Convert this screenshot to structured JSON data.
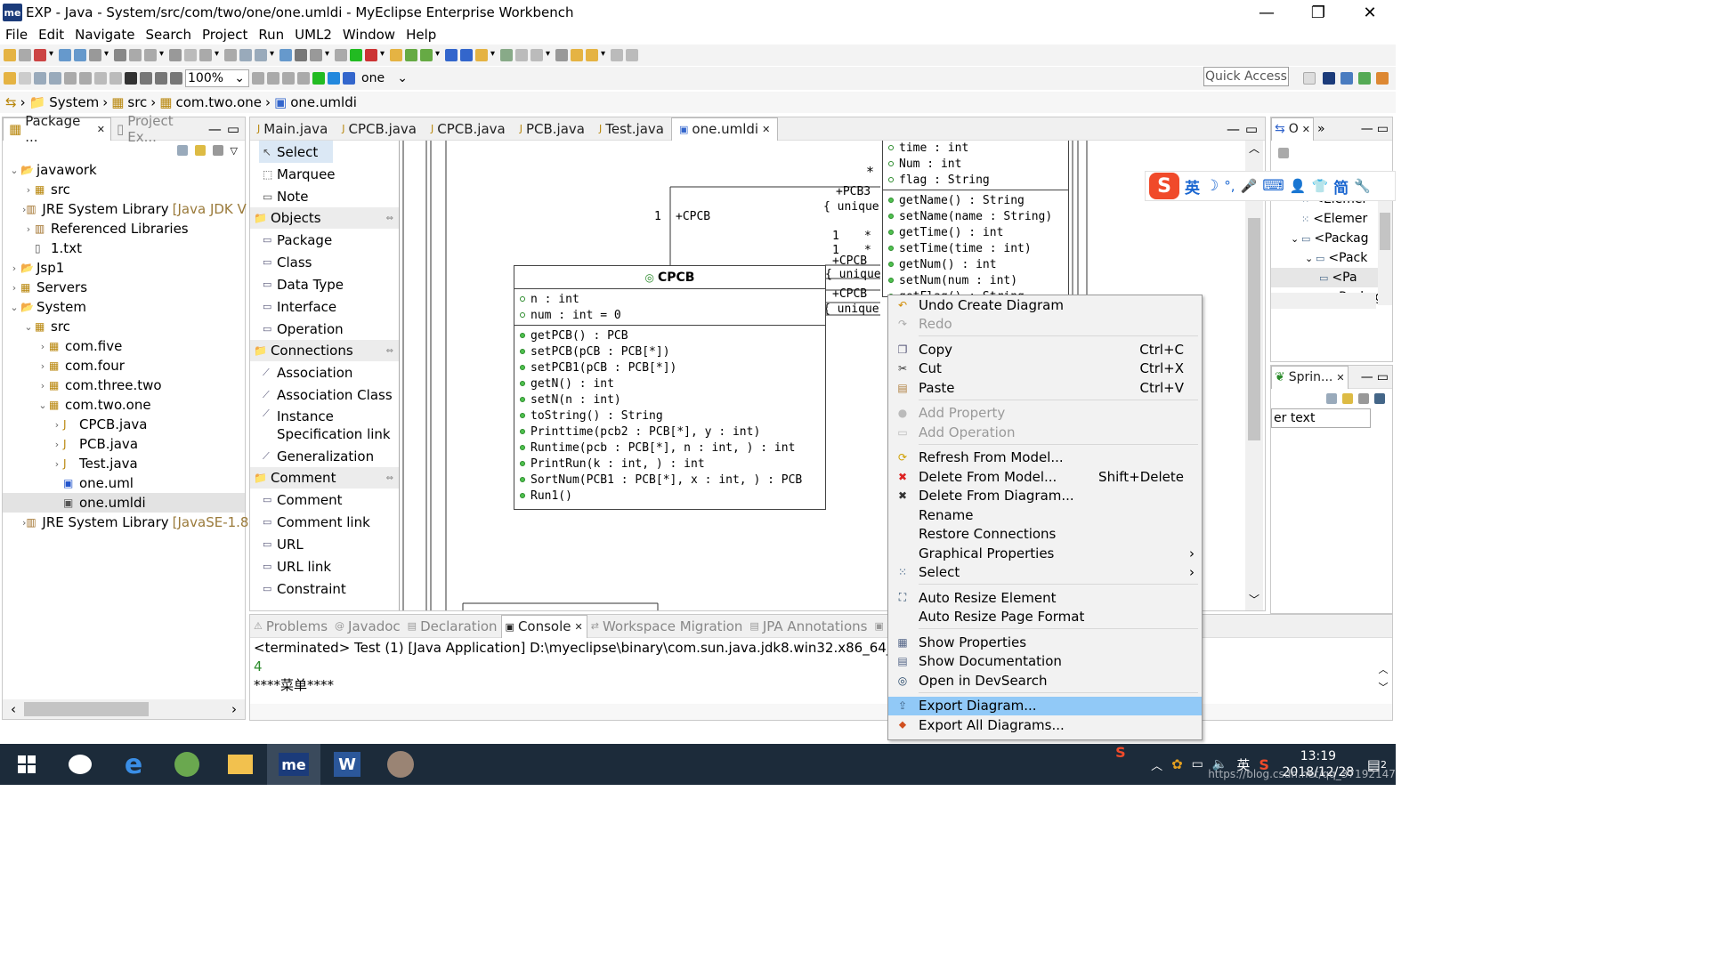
{
  "window": {
    "title": "EXP - Java - System/src/com/two/one/one.umldi - MyEclipse Enterprise Workbench",
    "app_icon": "me",
    "minimize": "—",
    "restore": "❐",
    "close": "✕"
  },
  "menu": [
    "File",
    "Edit",
    "Navigate",
    "Search",
    "Project",
    "Run",
    "UML2",
    "Window",
    "Help"
  ],
  "toolbar": {
    "zoom": "100%",
    "context": "one",
    "quick_access": "Quick Access"
  },
  "breadcrumb": [
    "System",
    "src",
    "com.two.one",
    "one.umldi"
  ],
  "explorer": {
    "tabs": [
      "Package ...",
      "Project Ex..."
    ],
    "tree": [
      {
        "label": "javawork",
        "level": 0,
        "exp": "v",
        "kind": "project"
      },
      {
        "label": "src",
        "level": 1,
        "exp": ">",
        "kind": "folder"
      },
      {
        "label": "JRE System Library",
        "decor": "[Java JDK V",
        "level": 1,
        "exp": ">",
        "kind": "lib"
      },
      {
        "label": "Referenced Libraries",
        "level": 1,
        "exp": ">",
        "kind": "lib"
      },
      {
        "label": "1.txt",
        "level": 1,
        "exp": "",
        "kind": "file"
      },
      {
        "label": "Jsp1",
        "level": 0,
        "exp": ">",
        "kind": "project"
      },
      {
        "label": "Servers",
        "level": 0,
        "exp": ">",
        "kind": "folder"
      },
      {
        "label": "System",
        "level": 0,
        "exp": "v",
        "kind": "project"
      },
      {
        "label": "src",
        "level": 1,
        "exp": "v",
        "kind": "folder"
      },
      {
        "label": "com.five",
        "level": 2,
        "exp": ">",
        "kind": "package"
      },
      {
        "label": "com.four",
        "level": 2,
        "exp": ">",
        "kind": "package"
      },
      {
        "label": "com.three.two",
        "level": 2,
        "exp": ">",
        "kind": "package"
      },
      {
        "label": "com.two.one",
        "level": 2,
        "exp": "v",
        "kind": "package"
      },
      {
        "label": "CPCB.java",
        "level": 3,
        "exp": ">",
        "kind": "java"
      },
      {
        "label": "PCB.java",
        "level": 3,
        "exp": ">",
        "kind": "java"
      },
      {
        "label": "Test.java",
        "level": 3,
        "exp": ">",
        "kind": "java"
      },
      {
        "label": "one.uml",
        "level": 3,
        "exp": "",
        "kind": "uml"
      },
      {
        "label": "one.umldi",
        "level": 3,
        "exp": "",
        "kind": "umldi",
        "selected": true
      },
      {
        "label": "JRE System Library",
        "decor": "[JavaSE-1.8]",
        "level": 1,
        "exp": ">",
        "kind": "lib"
      }
    ]
  },
  "editor_tabs": [
    "Main.java",
    "CPCB.java",
    "CPCB.java",
    "PCB.java",
    "Test.java",
    "one.umldi"
  ],
  "palette": {
    "tools": [
      "Select",
      "Marquee",
      "Note"
    ],
    "sections": [
      {
        "title": "Objects",
        "items": [
          "Package",
          "Class",
          "Data Type",
          "Interface",
          "Operation"
        ]
      },
      {
        "title": "Connections",
        "items": [
          "Association",
          "Association Class",
          "Instance Specification link",
          "Generalization"
        ]
      },
      {
        "title": "Comment",
        "items": [
          "Comment",
          "Comment link",
          "URL",
          "URL link",
          "Constraint"
        ]
      }
    ]
  },
  "diagram": {
    "class_name": "CPCB",
    "attributes": [
      "n : int",
      "num : int = 0"
    ],
    "operations": [
      "getPCB() : PCB",
      "setPCB(pCB : PCB[*])",
      "setPCB1(pCB : PCB[*])",
      "getN() : int",
      "setN(n : int)",
      "toString() : String",
      "Printtime(pcb2 : PCB[*], y : int)",
      "Runtime(pcb : PCB[*], n : int, ) : int",
      "PrintRun(k : int, ) : int",
      "SortNum(PCB1 : PCB[*], x : int, ) : PCB",
      "Run1()"
    ],
    "pcb_attributes": [
      "time : int",
      "Num : int",
      "flag : String"
    ],
    "pcb_operations": [
      "getName() : String",
      "setName(name : String)",
      "getTime() : int",
      "setTime(time : int)",
      "getNum() : int",
      "setNum(num : int)",
      "getFlag() : String"
    ],
    "labels": {
      "star1": "*",
      "pcb3": "+PCB3",
      "unique1": "{ unique",
      "one1": "1",
      "cpcb": "+CPCB",
      "one2": "1",
      "star2": "*",
      "one3": "1",
      "star3": "*",
      "m1": "+CPCB",
      "m2": "{ unique",
      "m3": "+CPCB",
      "m4": "{ unique",
      "unique3": "{ unique"
    }
  },
  "context_menu": [
    {
      "label": "Undo Create Diagram",
      "icon": "↶",
      "c": "#d08a00"
    },
    {
      "label": "Redo",
      "icon": "↷",
      "c": "#aaa",
      "disabled": true
    },
    {
      "sep": true
    },
    {
      "label": "Copy",
      "shortcut": "Ctrl+C",
      "icon": "❐",
      "c": "#557"
    },
    {
      "label": "Cut",
      "shortcut": "Ctrl+X",
      "icon": "✂",
      "c": "#333"
    },
    {
      "label": "Paste",
      "shortcut": "Ctrl+V",
      "icon": "▤",
      "c": "#b08040"
    },
    {
      "sep": true
    },
    {
      "label": "Add Property",
      "icon": "●",
      "c": "#bbb",
      "disabled": true
    },
    {
      "label": "Add Operation",
      "icon": "▭",
      "c": "#bbb",
      "disabled": true
    },
    {
      "sep": true
    },
    {
      "label": "Refresh From Model...",
      "icon": "⟳",
      "c": "#d0a000"
    },
    {
      "label": "Delete From Model...",
      "shortcut": "Shift+Delete",
      "icon": "✖",
      "c": "#d22"
    },
    {
      "label": "Delete From Diagram...",
      "icon": "✖",
      "c": "#333"
    },
    {
      "label": "Rename",
      "icon": "",
      "c": "#333"
    },
    {
      "label": "Restore Connections",
      "icon": "",
      "c": "#333"
    },
    {
      "label": "Graphical Properties",
      "submenu": true,
      "icon": "",
      "c": "#333"
    },
    {
      "label": "Select",
      "submenu": true,
      "icon": "⁙",
      "c": "#468"
    },
    {
      "sep": true
    },
    {
      "label": "Auto Resize Element",
      "icon": "⛶",
      "c": "#246"
    },
    {
      "label": "Auto Resize Page Format",
      "icon": "",
      "c": "#333"
    },
    {
      "sep": true
    },
    {
      "label": "Show Properties",
      "icon": "▦",
      "c": "#568"
    },
    {
      "label": "Show Documentation",
      "icon": "▤",
      "c": "#568"
    },
    {
      "label": "Open in DevSearch",
      "icon": "◎",
      "c": "#246"
    },
    {
      "sep": true
    },
    {
      "label": "Export Diagram...",
      "icon": "⇪",
      "c": "#468",
      "highlighted": true
    },
    {
      "label": "Export All Diagrams...",
      "icon": "⬥",
      "c": "#d05020"
    }
  ],
  "bottom": {
    "tabs": [
      "Problems",
      "Javadoc",
      "Declaration",
      "Console",
      "Workspace Migration",
      "JPA Annotations",
      "S"
    ],
    "active_tab": "Console",
    "console": [
      "<terminated> Test (1) [Java Application] D:\\myeclipse\\binary\\com.sun.java.jdk8.win32.x86_64_1.8.0.v1",
      "4",
      "****菜单****"
    ]
  },
  "outline": {
    "tab": "O",
    "items": [
      "<Elemer",
      "<Elemer",
      "<Packag",
      "<Pack",
      "<Pa",
      "<Packag"
    ]
  },
  "spring": {
    "tab": "Sprin...",
    "filter": "er text"
  },
  "ime": {
    "labels": [
      "英",
      "☽",
      "°,",
      "🎤",
      "⌨",
      "👤",
      "👕",
      "简",
      "🔧"
    ]
  },
  "taskbar": {
    "time": "13:19",
    "date": "2018/12/28",
    "ime": "英",
    "watermark": "https://blog.csdn.net/qq_37192147",
    "notif": "2"
  }
}
